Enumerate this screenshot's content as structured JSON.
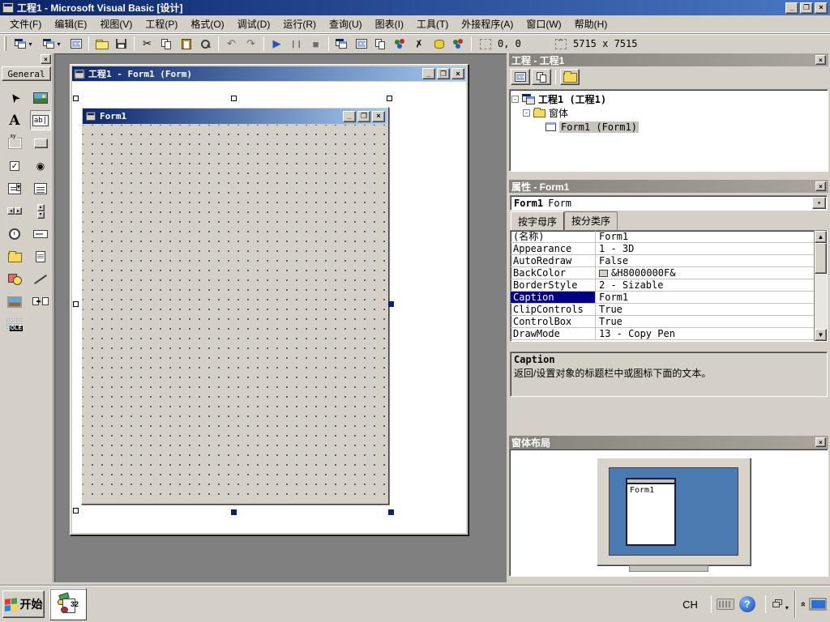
{
  "window": {
    "title": "工程1 - Microsoft Visual Basic [设计]",
    "minimize": "_",
    "restore": "❐",
    "close": "×"
  },
  "menu": {
    "items": [
      {
        "label": "文件(F)"
      },
      {
        "label": "编辑(E)"
      },
      {
        "label": "视图(V)"
      },
      {
        "label": "工程(P)"
      },
      {
        "label": "格式(O)"
      },
      {
        "label": "调试(D)"
      },
      {
        "label": "运行(R)"
      },
      {
        "label": "查询(U)"
      },
      {
        "label": "图表(I)"
      },
      {
        "label": "工具(T)"
      },
      {
        "label": "外接程序(A)"
      },
      {
        "label": "窗口(W)"
      },
      {
        "label": "帮助(H)"
      }
    ]
  },
  "toolbar": {
    "position_value": "0, 0",
    "size_value": "5715 x 7515",
    "glyphs": {
      "cut": "✂",
      "undo": "↶",
      "redo": "↷",
      "play": "▶",
      "pause": "❙❙",
      "stop": "■",
      "caret": "▾"
    }
  },
  "toolbox": {
    "tab": "General",
    "close": "×",
    "textbox_glyph": "ab|",
    "label_glyph": "A",
    "check_glyph": "✓",
    "option_glyph": "◉",
    "ole_glyph": "OLE"
  },
  "mdi": {
    "child_title": "工程1 - Form1 (Form)",
    "form_title": "Form1"
  },
  "project": {
    "title": "工程 - 工程1",
    "root": "工程1 (工程1)",
    "folder": "窗体",
    "form": "Form1 (Form1)",
    "expander": "-"
  },
  "properties": {
    "title": "属性 - Form1",
    "object_name": "Form1",
    "object_type": "Form",
    "tabs": [
      {
        "label": "按字母序"
      },
      {
        "label": "按分类序"
      }
    ],
    "rows": [
      {
        "name": "(名称)",
        "value": "Form1"
      },
      {
        "name": "Appearance",
        "value": "1 - 3D"
      },
      {
        "name": "AutoRedraw",
        "value": "False"
      },
      {
        "name": "BackColor",
        "value": "&H8000000F&"
      },
      {
        "name": "BorderStyle",
        "value": "2 - Sizable"
      },
      {
        "name": "Caption",
        "value": "Form1"
      },
      {
        "name": "ClipControls",
        "value": "True"
      },
      {
        "name": "ControlBox",
        "value": "True"
      },
      {
        "name": "DrawMode",
        "value": "13 - Copy Pen"
      }
    ],
    "selected_row": "Caption",
    "desc_title": "Caption",
    "desc_text": "返回/设置对象的标题栏中或图标下面的文本。"
  },
  "layout_panel": {
    "title": "窗体布局",
    "form_label": "Form1"
  },
  "taskbar": {
    "start": "开始",
    "tray_lang": "CH"
  },
  "icons": {
    "toolbox_tools": [
      "pointer",
      "picturebox",
      "label",
      "textbox",
      "frame",
      "commandbutton",
      "checkbox",
      "optionbutton",
      "combobox",
      "listbox",
      "hscrollbar",
      "vscrollbar",
      "timer",
      "drivelistbox",
      "dirlistbox",
      "filelistbox",
      "shape",
      "line",
      "image",
      "data",
      "ole"
    ],
    "toolbar_buttons": [
      "add-project",
      "add-form",
      "menu-editor",
      "open",
      "save",
      "cut",
      "copy",
      "paste",
      "find",
      "undo",
      "redo",
      "run",
      "pause",
      "stop",
      "project-explorer",
      "properties-window",
      "form-layout",
      "object-browser",
      "toolbox",
      "data-view",
      "component-manager"
    ]
  },
  "colors": {
    "titlebar_start": "#0a246a",
    "titlebar_end": "#a6caf0",
    "face": "#d4d0c8",
    "mdi_background": "#808080",
    "selection": "#000080",
    "layout_screen": "#4a7ab0"
  }
}
